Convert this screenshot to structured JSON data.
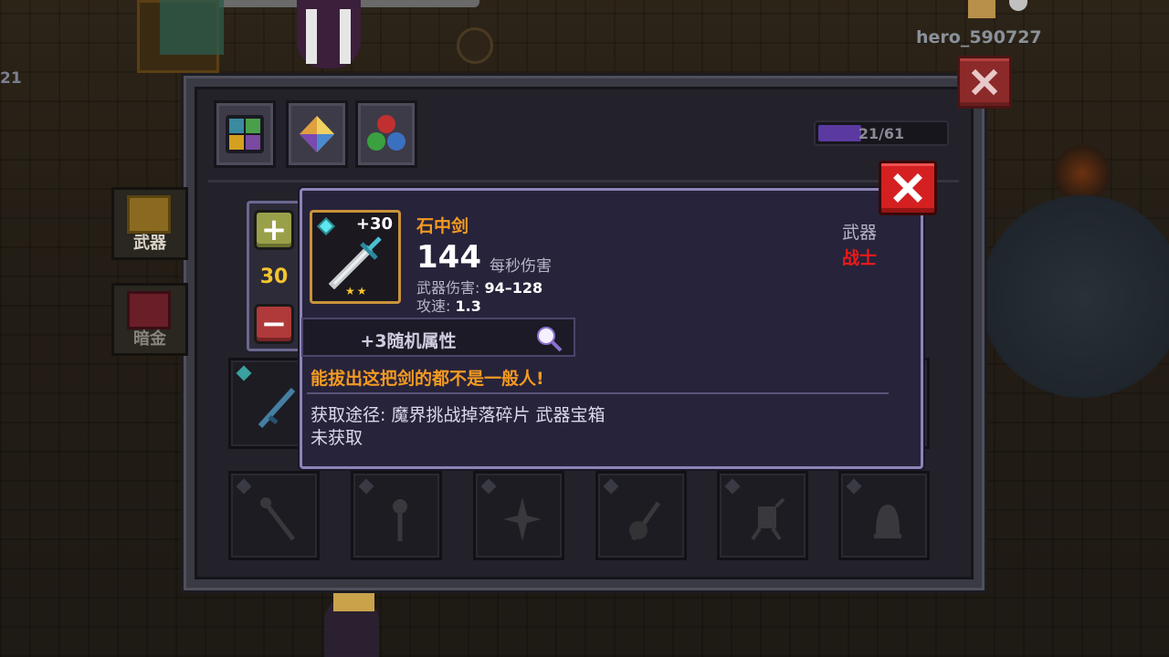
{
  "hud": {
    "player_name": "hero_590727",
    "left_number": "21"
  },
  "inventory": {
    "count": "21/61",
    "count_fraction": 0.34,
    "categories": [
      {
        "label": "武器",
        "icon": "sword-icon"
      },
      {
        "label": "暗金",
        "icon": "chest-icon"
      }
    ]
  },
  "stepper": {
    "value": "30",
    "plus_symbol": "+",
    "minus_symbol": "−"
  },
  "item": {
    "name": "石中剑",
    "level": "+30",
    "dps": "144",
    "dps_label": "每秒伤害",
    "damage_label": "武器伤害:",
    "damage_value": "94–128",
    "speed_label": "攻速:",
    "speed_value": "1.3",
    "type": "武器",
    "class": "战士",
    "random_attributes": "+3随机属性",
    "flavor": "能拔出这把剑的都不是一般人!",
    "source": "获取途径:  魔界挑战掉落碎片 武器宝箱",
    "status": "未获取",
    "stars": "★★"
  },
  "colors": {
    "rarity": "#f39a22",
    "class": "#ee1a1a",
    "close": "#d42020"
  }
}
